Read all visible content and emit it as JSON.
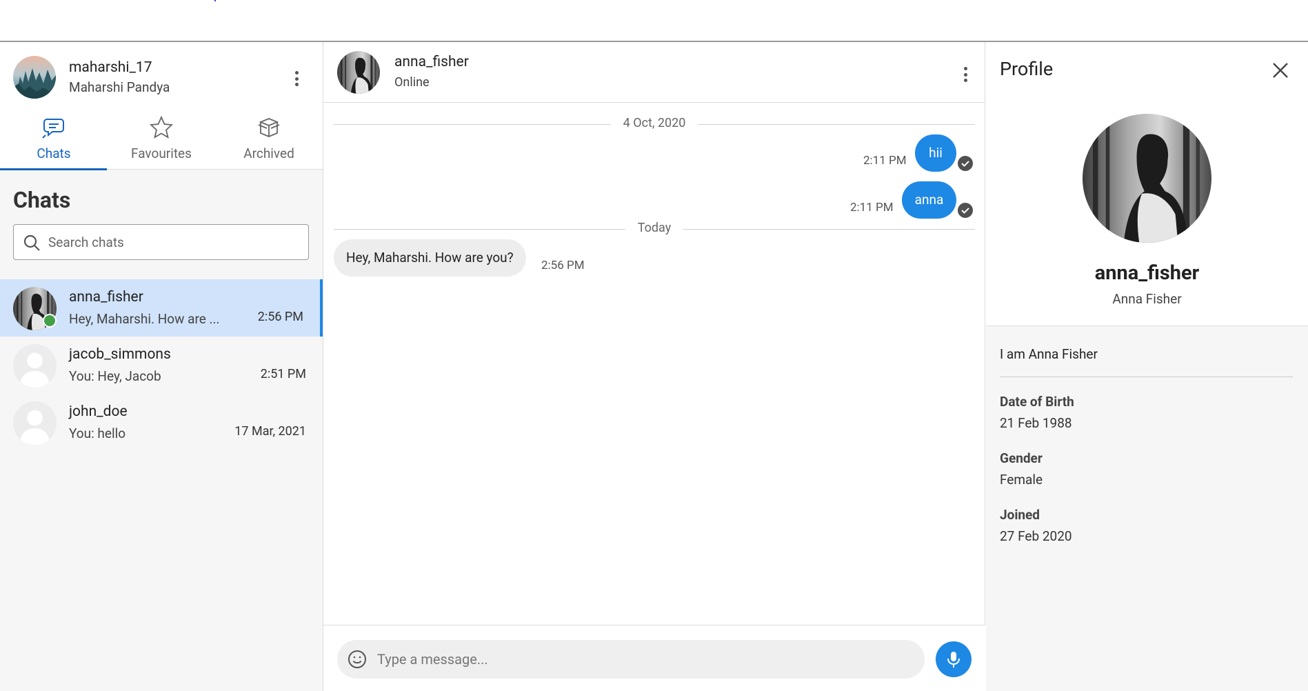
{
  "me": {
    "username": "maharshi_17",
    "full_name": "Maharshi Pandya"
  },
  "tabs": [
    {
      "label": "Chats",
      "active": true,
      "icon": "chat-bubbles-icon"
    },
    {
      "label": "Favourites",
      "active": false,
      "icon": "star-icon"
    },
    {
      "label": "Archived",
      "active": false,
      "icon": "archive-box-icon"
    }
  ],
  "sidebar": {
    "title": "Chats",
    "search_placeholder": "Search chats",
    "chats": [
      {
        "username": "anna_fisher",
        "preview": "Hey, Maharshi. How are ...",
        "time": "2:56 PM",
        "active": true,
        "online": true
      },
      {
        "username": "jacob_simmons",
        "preview": "You: Hey, Jacob",
        "time": "2:51 PM",
        "active": false,
        "online": false
      },
      {
        "username": "john_doe",
        "preview": "You: hello",
        "time": "17 Mar, 2021",
        "active": false,
        "online": false
      }
    ]
  },
  "conversation": {
    "username": "anna_fisher",
    "status": "Online",
    "dividers": [
      "4 Oct, 2020",
      "Today"
    ],
    "messages": [
      {
        "direction": "out",
        "text": "hii",
        "time": "2:11 PM",
        "delivered": true
      },
      {
        "direction": "out",
        "text": "anna",
        "time": "2:11 PM",
        "delivered": true
      },
      {
        "direction": "in",
        "text": "Hey, Maharshi. How are you?",
        "time": "2:56 PM"
      }
    ],
    "composer_placeholder": "Type a message..."
  },
  "profile": {
    "title": "Profile",
    "username": "anna_fisher",
    "full_name": "Anna Fisher",
    "bio": "I am Anna Fisher",
    "fields": [
      {
        "label": "Date of Birth",
        "value": "21 Feb 1988"
      },
      {
        "label": "Gender",
        "value": "Female"
      },
      {
        "label": "Joined",
        "value": "27 Feb 2020"
      }
    ]
  },
  "colors": {
    "accent": "#1e88e5",
    "tab_active": "#1565c0",
    "active_chat_bg": "#d0e3fb",
    "online": "#43a047",
    "incoming_bubble": "#ededed"
  }
}
